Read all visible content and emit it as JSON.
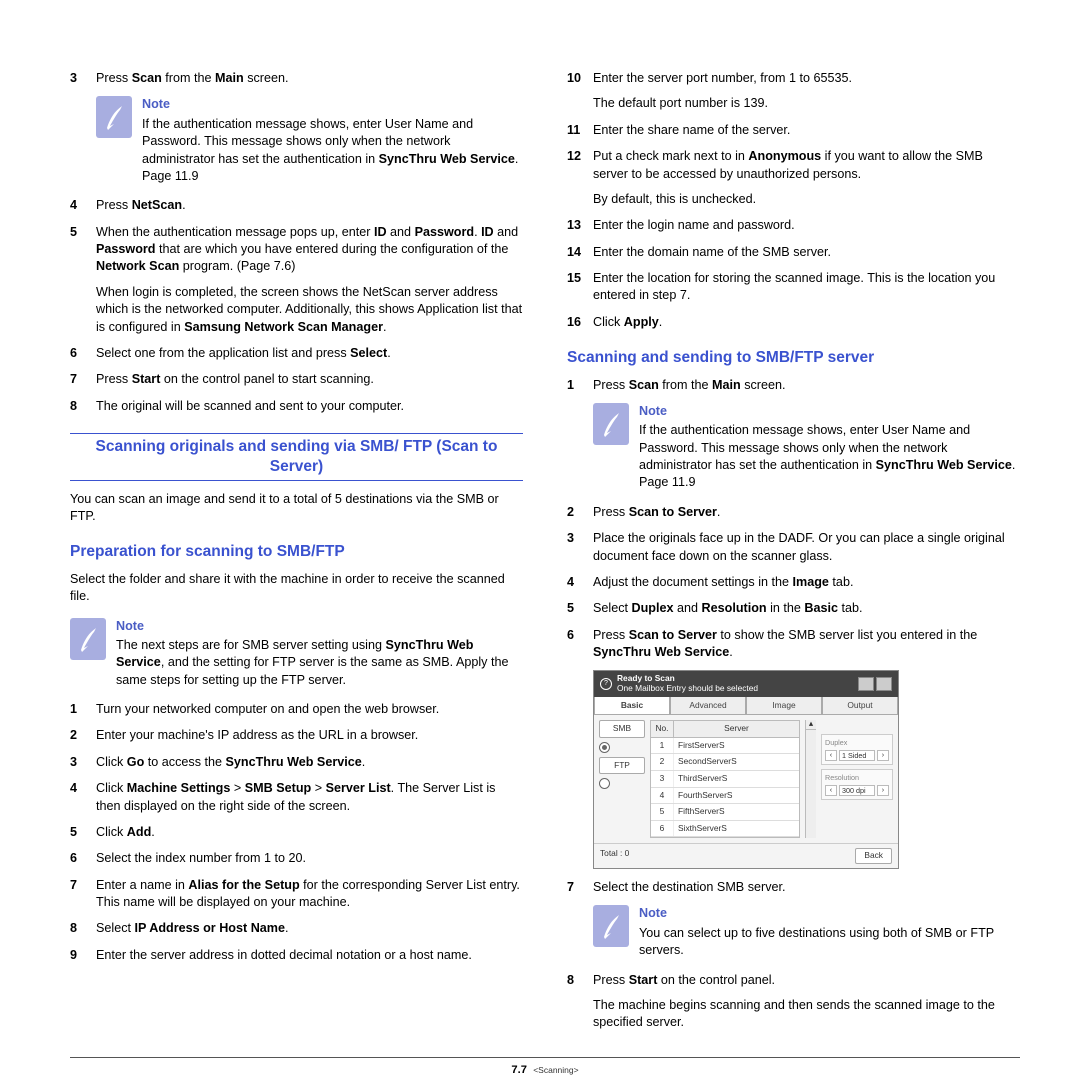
{
  "footer": {
    "page": "7.7",
    "chapter": "<Scanning>"
  },
  "note_label": "Note",
  "left": {
    "s3": {
      "text_pre": "Press ",
      "b1": "Scan",
      "text_mid": " from the ",
      "b2": "Main",
      "text_post": " screen."
    },
    "note1": {
      "line": "If the authentication message shows, enter User Name and Password. This message shows only when the network administrator has set the authentication in ",
      "b": "SyncThru Web Service",
      "post": ". Page 11.9"
    },
    "s4": {
      "pre": "Press ",
      "b": "NetScan",
      "post": "."
    },
    "s5": {
      "p1_pre": "When the authentication message pops up, enter ",
      "p1_b1": "ID",
      "p1_mid": " and ",
      "p1_b2": "Password",
      "p1_mid2": ". ",
      "p1_b3": "ID",
      "p1_mid3": " and ",
      "p1_b4": "Password",
      "p1_mid4": " that are which you have entered during the configuration of the ",
      "p1_b5": "Network Scan",
      "p1_post": " program. (Page 7.6)",
      "p2_pre": "When login is completed, the screen shows the NetScan server address which is the networked computer. Additionally, this shows Application list that is configured in ",
      "p2_b1": "Samsung Network Scan Manager",
      "p2_post": "."
    },
    "s6": {
      "pre": "Select one from the application list and press ",
      "b": "Select",
      "post": "."
    },
    "s7": {
      "pre": "Press ",
      "b": "Start",
      "post": " on the control panel to start scanning."
    },
    "s8": "The original will be scanned and sent to your computer.",
    "section_title": "Scanning originals and sending via SMB/ FTP (Scan to Server)",
    "section_intro": "You can scan an image and send it to a total of 5 destinations via the SMB or FTP.",
    "sub_title": "Preparation for scanning to SMB/FTP",
    "sub_intro": "Select the folder and share it with the machine in order to receive the scanned file.",
    "note2": {
      "pre": "The next steps are for SMB server setting using ",
      "b": "SyncThru Web Service",
      "post": ", and the setting for FTP server is the same as SMB. Apply the same steps for setting up the FTP server."
    },
    "p1": "Turn your networked computer on and open the web browser.",
    "p2": "Enter your machine's IP address as the URL in a browser.",
    "p3": {
      "pre": "Click ",
      "b1": "Go",
      "mid": " to access the ",
      "b2": "SyncThru Web Service",
      "post": "."
    },
    "p4": {
      "pre": "Click ",
      "b1": "Machine Settings",
      "mid1": " > ",
      "b2": "SMB Setup",
      "mid2": " > ",
      "b3": "Server List",
      "post": ". The Server List is then displayed on the right side of the screen."
    },
    "p5": {
      "pre": "Click ",
      "b": "Add",
      "post": "."
    },
    "p6": "Select the index number from 1 to 20.",
    "p7": {
      "pre": "Enter a name in ",
      "b": "Alias for the Setup",
      "post": " for the corresponding Server List entry. This name will be displayed on your machine."
    },
    "p8": {
      "pre": "Select ",
      "b": "IP Address or Host Name",
      "post": "."
    },
    "p9": "Enter the server address in dotted decimal notation or a host name."
  },
  "right": {
    "s10": "Enter the server port number, from 1 to 65535.",
    "s10b": "The default port number is 139.",
    "s11": "Enter the share name of the server.",
    "s12": {
      "pre": "Put a check mark next to in ",
      "b": "Anonymous",
      "post": " if you want to allow the SMB server to be accessed by unauthorized persons."
    },
    "s12b": "By default, this is unchecked.",
    "s13": "Enter the login name and password.",
    "s14": "Enter the domain name of the SMB server.",
    "s15": "Enter the location for storing the scanned image. This is the location you entered in step 7.",
    "s16": {
      "pre": "Click ",
      "b": "Apply",
      "post": "."
    },
    "sub_title": "Scanning and sending to SMB/FTP server",
    "t1": {
      "pre": "Press ",
      "b1": "Scan",
      "mid": " from the ",
      "b2": "Main",
      "post": " screen."
    },
    "note3": {
      "line": "If the authentication message shows, enter User Name and Password. This message shows only when the network administrator has set the authentication in ",
      "b": "SyncThru Web Service",
      "post": ". Page 11.9"
    },
    "t2": {
      "pre": "Press ",
      "b": "Scan to Server",
      "post": "."
    },
    "t3": "Place the originals face up in the DADF. Or you can place a single original document face down on the scanner glass.",
    "t4": {
      "pre": "Adjust the document settings in the ",
      "b": "Image",
      "post": " tab."
    },
    "t5": {
      "pre": "Select ",
      "b1": "Duplex",
      "mid": " and ",
      "b2": "Resolution",
      "mid2": " in the ",
      "b3": "Basic",
      "post": " tab."
    },
    "t6": {
      "pre": "Press ",
      "b1": "Scan to Server",
      "mid": " to show the SMB server list you entered in the ",
      "b2": "SyncThru Web Service",
      "post": "."
    },
    "shot": {
      "title1": "Ready to Scan",
      "title2": "One Mailbox Entry should be selected",
      "tabs": [
        "Basic",
        "Advanced",
        "Image",
        "Output"
      ],
      "protocols": [
        "SMB",
        "FTP"
      ],
      "cols": [
        "No.",
        "Server"
      ],
      "rows": [
        [
          "1",
          "FirstServerS"
        ],
        [
          "2",
          "SecondServerS"
        ],
        [
          "3",
          "ThirdServerS"
        ],
        [
          "4",
          "FourthServerS"
        ],
        [
          "5",
          "FifthServerS"
        ],
        [
          "6",
          "SixthServerS"
        ]
      ],
      "duplex_label": "Duplex",
      "duplex_value": "1 Sided",
      "res_label": "Resolution",
      "res_value": "300 dpi",
      "total": "Total : 0",
      "back": "Back"
    },
    "t7": "Select the destination SMB server.",
    "note4": "You can select up to five destinations using both of SMB or FTP servers.",
    "t8": {
      "pre": "Press ",
      "b": "Start",
      "post": " on the control panel."
    },
    "t8b": "The machine begins scanning and then sends the scanned image to the specified server."
  }
}
